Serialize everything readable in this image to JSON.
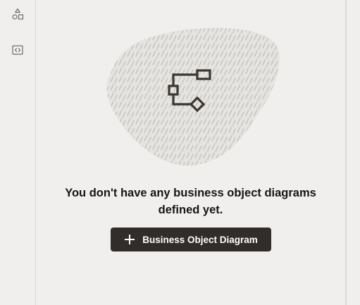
{
  "colors": {
    "background": "#f1efed",
    "text": "#161513",
    "button_background": "#312d2a",
    "button_text": "#ffffff",
    "illustration_blob": "#d4d2cf",
    "icon_stroke": "#3a3632"
  },
  "left_rail": {
    "items": [
      {
        "icon": "shapes-icon"
      },
      {
        "icon": "code-icon"
      }
    ]
  },
  "empty_state": {
    "illustration_icon": "diagram-flow-icon",
    "message_line1": "You don't have any business object diagrams",
    "message_line2": "defined yet.",
    "button_label": "Business Object Diagram",
    "button_icon": "plus-icon"
  }
}
